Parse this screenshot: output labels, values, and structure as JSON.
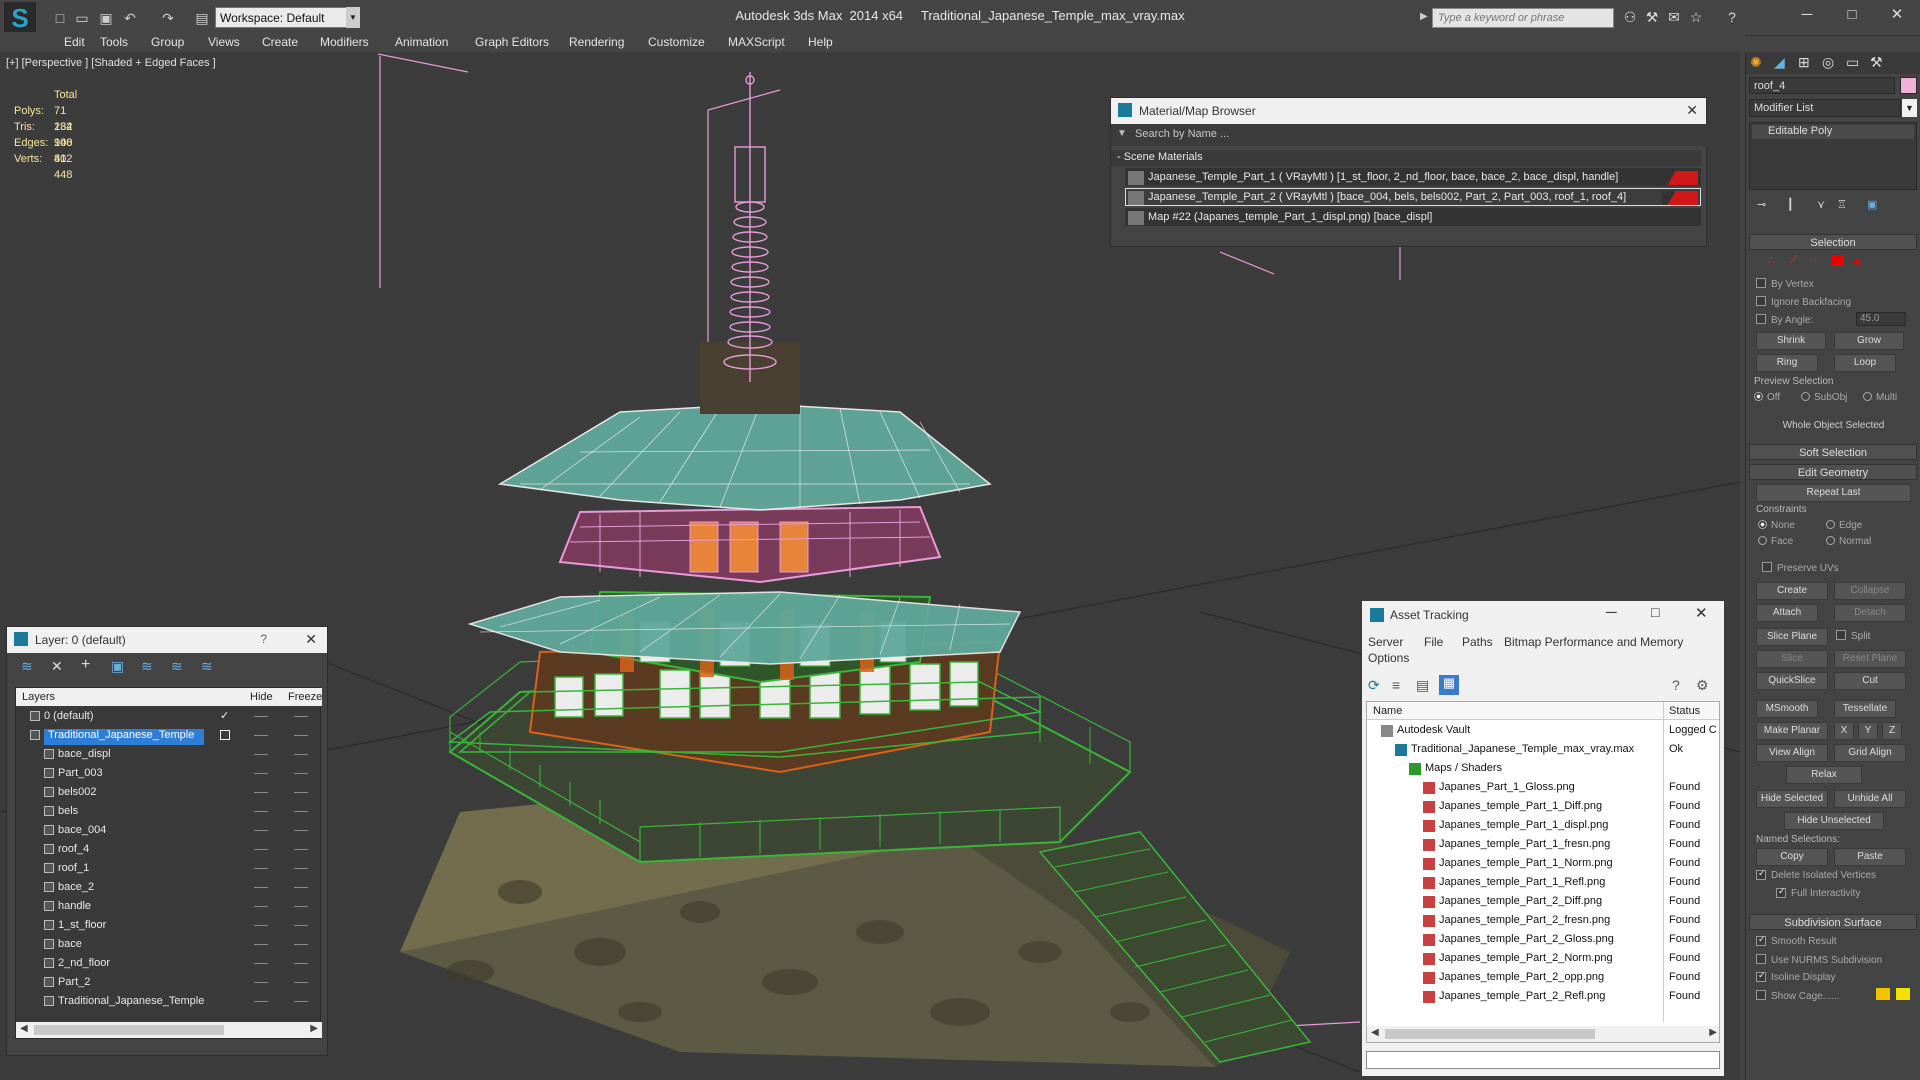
{
  "window": {
    "app_title": "Autodesk 3ds Max  2014 x64     Traditional_Japanese_Temple_max_vray.max",
    "workspace_label": "Workspace: Default",
    "search_placeholder": "Type a keyword or phrase"
  },
  "menubar": [
    "Edit",
    "Tools",
    "Group",
    "Views",
    "Create",
    "Modifiers",
    "Animation",
    "Graph Editors",
    "Rendering",
    "Customize",
    "MAXScript",
    "Help"
  ],
  "viewport": {
    "label": "[+] [Perspective ] [Shaded + Edged Faces ]",
    "stats": {
      "header": "Total",
      "rows": [
        {
          "label": "Polys:",
          "value": "71 282"
        },
        {
          "label": "Tris:",
          "value": "134 900"
        },
        {
          "label": "Edges:",
          "value": "148 412"
        },
        {
          "label": "Verts:",
          "value": "80 448"
        }
      ]
    }
  },
  "material_browser": {
    "title": "Material/Map Browser",
    "search_placeholder": "Search by Name ...",
    "section": "- Scene Materials",
    "rows": [
      "Japanese_Temple_Part_1  ( VRayMtl )  [1_st_floor, 2_nd_floor, bace, bace_2, bace_displ, handle]",
      "Japanese_Temple_Part_2  ( VRayMtl )  [bace_004, bels, bels002, Part_2, Part_003, roof_1, roof_4]",
      "Map #22 (Japanes_temple_Part_1_displ.png) [bace_displ]"
    ]
  },
  "layer_panel": {
    "title": "Layer: 0 (default)",
    "help": "?",
    "columns": {
      "layers": "Layers",
      "hide": "Hide",
      "freeze": "Freeze"
    },
    "layers": [
      {
        "name": "0 (default)",
        "level": 0,
        "selected": false
      },
      {
        "name": "Traditional_Japanese_Temple",
        "level": 0,
        "selected": true
      },
      {
        "name": "bace_displ",
        "level": 1,
        "selected": false
      },
      {
        "name": "Part_003",
        "level": 1,
        "selected": false
      },
      {
        "name": "bels002",
        "level": 1,
        "selected": false
      },
      {
        "name": "bels",
        "level": 1,
        "selected": false
      },
      {
        "name": "bace_004",
        "level": 1,
        "selected": false
      },
      {
        "name": "roof_4",
        "level": 1,
        "selected": false
      },
      {
        "name": "roof_1",
        "level": 1,
        "selected": false
      },
      {
        "name": "bace_2",
        "level": 1,
        "selected": false
      },
      {
        "name": "handle",
        "level": 1,
        "selected": false
      },
      {
        "name": "1_st_floor",
        "level": 1,
        "selected": false
      },
      {
        "name": "bace",
        "level": 1,
        "selected": false
      },
      {
        "name": "2_nd_floor",
        "level": 1,
        "selected": false
      },
      {
        "name": "Part_2",
        "level": 1,
        "selected": false
      },
      {
        "name": "Traditional_Japanese_Temple",
        "level": 1,
        "selected": false
      }
    ]
  },
  "asset_tracking": {
    "title": "Asset Tracking",
    "menu": [
      "Server",
      "File",
      "Paths",
      "Bitmap Performance and Memory",
      "Options"
    ],
    "columns": {
      "name": "Name",
      "status": "Status"
    },
    "rows": [
      {
        "name": "Autodesk Vault",
        "status": "Logged C",
        "level": 0,
        "kind": "vault"
      },
      {
        "name": "Traditional_Japanese_Temple_max_vray.max",
        "status": "Ok",
        "level": 1,
        "kind": "max"
      },
      {
        "name": "Maps / Shaders",
        "status": "",
        "level": 2,
        "kind": "folder"
      },
      {
        "name": "Japanes_Part_1_Gloss.png",
        "status": "Found",
        "level": 3,
        "kind": "png"
      },
      {
        "name": "Japanes_temple_Part_1_Diff.png",
        "status": "Found",
        "level": 3,
        "kind": "png"
      },
      {
        "name": "Japanes_temple_Part_1_displ.png",
        "status": "Found",
        "level": 3,
        "kind": "png"
      },
      {
        "name": "Japanes_temple_Part_1_fresn.png",
        "status": "Found",
        "level": 3,
        "kind": "png"
      },
      {
        "name": "Japanes_temple_Part_1_Norm.png",
        "status": "Found",
        "level": 3,
        "kind": "png"
      },
      {
        "name": "Japanes_temple_Part_1_Refl.png",
        "status": "Found",
        "level": 3,
        "kind": "png"
      },
      {
        "name": "Japanes_temple_Part_2_Diff.png",
        "status": "Found",
        "level": 3,
        "kind": "png"
      },
      {
        "name": "Japanes_temple_Part_2_fresn.png",
        "status": "Found",
        "level": 3,
        "kind": "png"
      },
      {
        "name": "Japanes_temple_Part_2_Gloss.png",
        "status": "Found",
        "level": 3,
        "kind": "png"
      },
      {
        "name": "Japanes_temple_Part_2_Norm.png",
        "status": "Found",
        "level": 3,
        "kind": "png"
      },
      {
        "name": "Japanes_temple_Part_2_opp.png",
        "status": "Found",
        "level": 3,
        "kind": "png"
      },
      {
        "name": "Japanes_temple_Part_2_Refl.png",
        "status": "Found",
        "level": 3,
        "kind": "png"
      }
    ]
  },
  "command_panel": {
    "object_name": "roof_4",
    "modifier_list": "Modifier List",
    "stack_item": "Editable Poly",
    "selection": {
      "title": "Selection",
      "by_vertex": "By Vertex",
      "ignore_backfacing": "Ignore Backfacing",
      "by_angle": "By Angle:",
      "angle_value": "45.0",
      "shrink": "Shrink",
      "grow": "Grow",
      "ring": "Ring",
      "loop": "Loop",
      "preview_label": "Preview Selection",
      "preview_off": "Off",
      "preview_subobj": "SubObj",
      "preview_multi": "Multi",
      "status": "Whole Object Selected"
    },
    "soft_selection": "Soft Selection",
    "edit_geometry": {
      "title": "Edit Geometry",
      "repeat_last": "Repeat Last",
      "constraints": "Constraints",
      "c_none": "None",
      "c_edge": "Edge",
      "c_face": "Face",
      "c_normal": "Normal",
      "preserve_uvs": "Preserve UVs",
      "create": "Create",
      "collapse": "Collapse",
      "attach": "Attach",
      "detach": "Detach",
      "slice_plane": "Slice Plane",
      "split": "Split",
      "slice": "Slice",
      "reset_plane": "Reset Plane",
      "quickslice": "QuickSlice",
      "cut": "Cut",
      "msmooth": "MSmooth",
      "tessellate": "Tessellate",
      "make_planar": "Make Planar",
      "x": "X",
      "y": "Y",
      "z": "Z",
      "view_align": "View Align",
      "grid_align": "Grid Align",
      "relax": "Relax",
      "hide_selected": "Hide Selected",
      "unhide_all": "Unhide All",
      "hide_unselected": "Hide Unselected",
      "named_selections": "Named Selections:",
      "copy": "Copy",
      "paste": "Paste",
      "delete_isolated": "Delete Isolated Vertices",
      "full_interactivity": "Full Interactivity"
    },
    "subdivision": {
      "title": "Subdivision Surface",
      "smooth_result": "Smooth Result",
      "use_nurms": "Use NURMS Subdivision",
      "isoline": "Isoline Display",
      "show_cage": "Show Cage......"
    }
  },
  "colors": {
    "wire_pink": "#e79bd8",
    "wire_green": "#39b53a",
    "wire_orange": "#d8621a",
    "roof_teal": "#5fa89a",
    "stone": "#6b6548",
    "selection_blue": "#2e7ed8",
    "material_red": "#d01818"
  }
}
